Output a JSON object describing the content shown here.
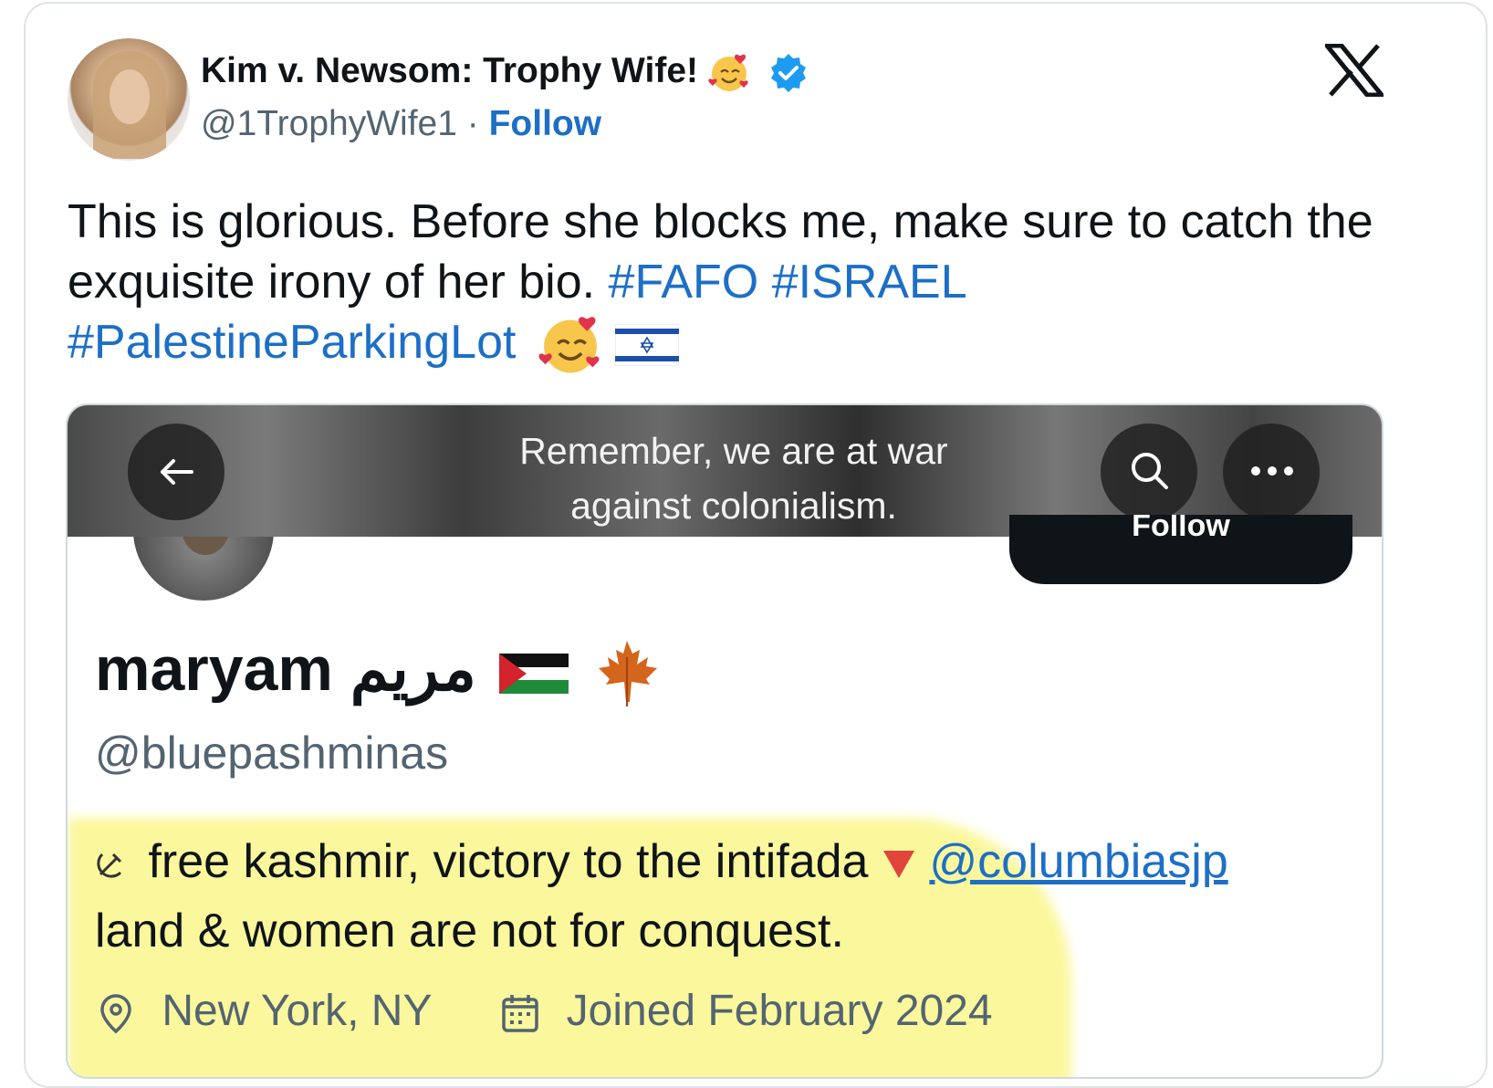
{
  "tweet": {
    "author": {
      "display_name": "Kim v. Newsom: Trophy Wife!",
      "handle": "@1TrophyWife1",
      "separator": "·",
      "follow_label": "Follow",
      "verified": true
    },
    "text_before": "This is glorious. Before she blocks me, make sure to catch the exquisite irony of her bio.",
    "hashtags": [
      "#FAFO",
      "#ISRAEL",
      "#PalestineParkingLot"
    ],
    "emoji": [
      "smiling-face-with-hearts",
      "israel-flag"
    ]
  },
  "embedded_profile": {
    "banner_text": "Remember, we are at war against colonialism.",
    "follow_button_label": "Follow",
    "name": "maryam",
    "name_arabic": "مريم",
    "name_emoji": [
      "palestine-flag",
      "maple-leaf"
    ],
    "handle": "@bluepashminas",
    "bio_line1": "free kashmir, victory to the intifada",
    "bio_mention": "@columbiasjp",
    "bio_line2": "land & women are not for conquest.",
    "location": "New York, NY",
    "joined": "Joined February 2024"
  },
  "colors": {
    "link": "#1d6fc6",
    "secondary_text": "#536471",
    "verified_badge": "#1d9bf0",
    "highlight": "#fbf79c"
  }
}
